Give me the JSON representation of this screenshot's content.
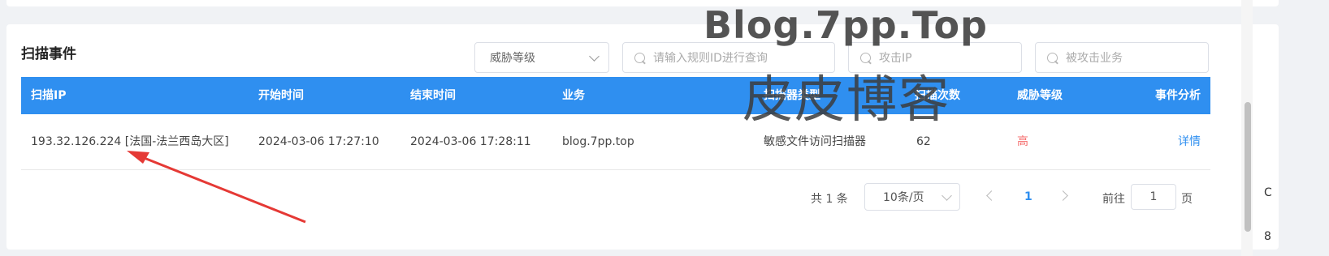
{
  "section": {
    "title": "扫描事件"
  },
  "filters": {
    "threat_level_select": "威胁等级",
    "rule_id_placeholder": "请输入规则ID进行查询",
    "attack_ip_placeholder": "攻击IP",
    "target_business_placeholder": "被攻击业务"
  },
  "table": {
    "columns": [
      "扫描IP",
      "开始时间",
      "结束时间",
      "业务",
      "扫描器类型",
      "扫描次数",
      "威胁等级",
      "事件分析"
    ],
    "rows": [
      {
        "ip": "193.32.126.224 [法国-法兰西岛大区]",
        "start_time": "2024-03-06 17:27:10",
        "end_time": "2024-03-06 17:28:11",
        "business": "blog.7pp.top",
        "scanner_type": "敏感文件访问扫描器",
        "scan_count": "62",
        "threat_level": "高",
        "action": "详情"
      }
    ]
  },
  "pagination": {
    "total_text": "共 1 条",
    "page_size": "10条/页",
    "current_page": "1",
    "goto_label": "前往",
    "goto_value": "1",
    "page_unit": "页"
  },
  "watermark": {
    "en": "Blog.7pp.Top",
    "cn": "皮皮博客"
  },
  "edge_glyphs": [
    "C",
    "8"
  ],
  "colors": {
    "header_blue": "#2f8ff0",
    "danger_red": "#f56c6c",
    "arrow_red": "#e53935"
  }
}
